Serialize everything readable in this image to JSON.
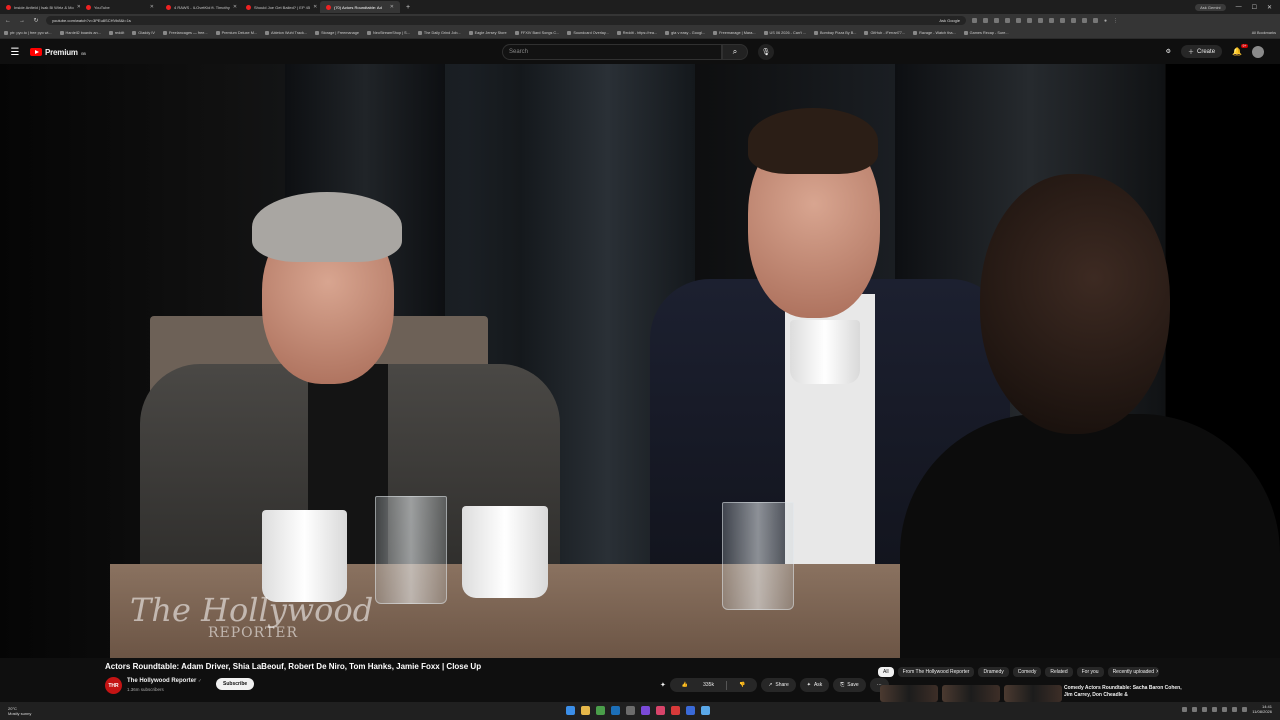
{
  "browser": {
    "tabs": [
      {
        "label": "Inside Anfield | Isak Bi Wirtz & Mo",
        "active": false
      },
      {
        "label": "YouTube",
        "active": false
      },
      {
        "label": "4 RAWS - ILOvetKid ft. Timothy",
        "active": false
      },
      {
        "label": "Should Joe Get Bailed? | EP 45",
        "active": false
      },
      {
        "label": "(70) Actors Roundtable: Ad",
        "active": true
      }
    ],
    "new_tab": "+",
    "ask_gemini": "Ask Gemini",
    "url": "youtube.com/watch?v=3PEu8SCHVb8&t=1s",
    "ask_google": "Ask Google",
    "bookmarks": [
      "ptr: pyo.to | free pyo wi...",
      "Hardell2 boards an...",
      "reddit",
      "Gladdy IV",
      "Freelancages — free...",
      "Premium Deluxe M...",
      "Ableton Wuhi Track...",
      "Storage | Freemanage",
      "NeoStreamShop | S...",
      "The Daily Grind Job...",
      "Eagle Jersey Store",
      "FFXIV Bard Songs C...",
      "Soundcard Overlay...",
      "Reddit - https://rea...",
      "gta v easy - Googl...",
      "Freemanage | Mara...",
      "US 06 2026 - Can't ...",
      "Bombay Pizza By B...",
      "GitHub - iFerrari77...",
      "Ravage - Watch tha...",
      "Games Recap - Sure..."
    ],
    "all_bookmarks": "All Bookmarks"
  },
  "youtube": {
    "brand": "Premium",
    "brand_region": "GB",
    "search_placeholder": "Search",
    "create_label": "Create",
    "notif_badge": "9+"
  },
  "video": {
    "watermark_line1": "The Hollywood",
    "watermark_line2": "REPORTER",
    "title": "Actors Roundtable: Adam Driver, Shia LaBeouf, Robert De Niro, Tom Hanks, Jamie Foxx | Close Up",
    "channel_avatar": "THR",
    "channel_name": "The Hollywood Reporter",
    "channel_verified": "✓",
    "subscribers": "1.36m subscribers",
    "subscribe_label": "Subscribe",
    "likes": "335k",
    "share_label": "Share",
    "ask_label": "Ask",
    "save_label": "Save",
    "more_label": "···"
  },
  "related": {
    "chips": [
      "All",
      "From The Hollywood Reporter",
      "Dramedy",
      "Comedy",
      "Related",
      "For you",
      "Recently uploaded"
    ],
    "first_title": "Comedy Actors Roundtable: Sacha Baron Cohen, Jim Carrey, Don Cheadle &"
  },
  "taskbar": {
    "weather_temp": "20°C",
    "weather_desc": "Mostly sunny",
    "time": "14:41",
    "date": "11/08/2026"
  },
  "colors": {
    "yt_red": "#ff0000",
    "background": "#0f0f0f",
    "chip_bg": "#272727"
  }
}
